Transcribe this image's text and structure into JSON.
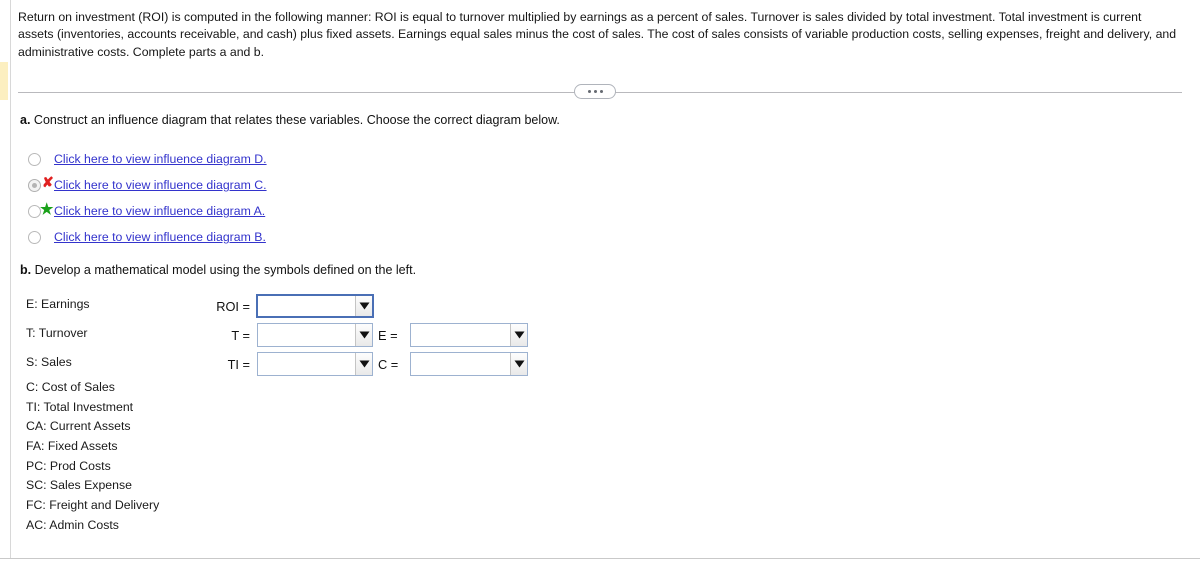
{
  "intro": {
    "paragraph": "Return on investment (ROI) is computed in the following manner: ROI is equal to turnover multiplied by earnings as a percent of sales. Turnover is sales divided by total investment. Total investment is current assets (inventories, accounts receivable, and cash) plus fixed assets. Earnings equal sales minus the cost of sales. The cost of sales consists of variable production costs, selling expenses, freight and delivery, and administrative costs. Complete parts a and b."
  },
  "divider": {
    "expander_label": "..."
  },
  "part_a": {
    "lead": "a.",
    "prompt": "Construct an influence diagram that relates these variables. Choose the correct diagram below.",
    "choices": [
      {
        "label": "Click here to view influence diagram D.",
        "state": "unselected",
        "mark": ""
      },
      {
        "label": "Click here to view influence diagram C.",
        "state": "selected",
        "mark": "✘"
      },
      {
        "label": "Click here to view influence diagram A.",
        "state": "unselected",
        "mark": "★"
      },
      {
        "label": "Click here to view influence diagram B.",
        "state": "unselected",
        "mark": ""
      }
    ]
  },
  "part_b": {
    "lead": "b.",
    "prompt": "Develop a mathematical model using the symbols defined on the left.",
    "legend": [
      "E: Earnings",
      "T: Turnover",
      "S: Sales",
      "C: Cost of Sales",
      "TI: Total Investment",
      "CA: Current Assets",
      "FA: Fixed Assets",
      "PC: Prod Costs",
      "SC: Sales Expense",
      "FC: Freight and Delivery",
      "AC: Admin Costs"
    ],
    "equations": [
      {
        "label": "ROI =",
        "value": "",
        "focused": true
      },
      {
        "label": "T =",
        "value": "",
        "focused": false
      },
      {
        "label": "TI =",
        "value": "",
        "focused": false
      }
    ],
    "equations_right": [
      {
        "label": "E =",
        "value": "",
        "focused": false
      },
      {
        "label": "C =",
        "value": "",
        "focused": false
      }
    ]
  },
  "colors": {
    "link": "#3333CC",
    "wrong_mark": "#E02020",
    "correct_mark": "#1AA11A",
    "focus_border": "#4A6FB5",
    "field_border": "#9DB2D0",
    "highlight_marker": "#FCEFC0"
  }
}
